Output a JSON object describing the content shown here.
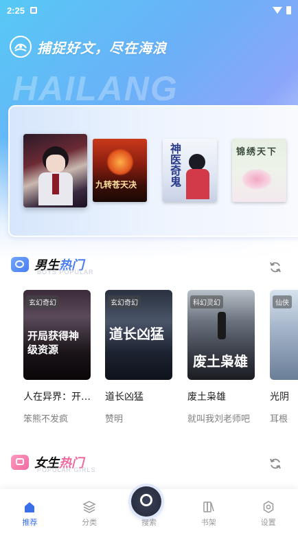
{
  "status_bar": {
    "time": "2:25"
  },
  "hero": {
    "slogan": "捕捉好文，尽在海浪",
    "watermark": "HAILANG"
  },
  "carousel": {
    "covers": [
      {
        "name": "anime-character-cover",
        "text": ""
      },
      {
        "name": "jiuxing-cover",
        "text": "九转苍天决"
      },
      {
        "name": "shenyi-cover",
        "text": "神医奇鬼"
      },
      {
        "name": "jinxiu-cover",
        "text": "锦绣天下"
      }
    ]
  },
  "sections": [
    {
      "title_main": "男生",
      "title_accent": "热门",
      "subtitle": "BOYS POPULAR",
      "books": [
        {
          "title": "人在异界：开…",
          "author": "笨熊不发疯",
          "tag": "玄幻奇幻",
          "cover_text": "开局获得神级资源"
        },
        {
          "title": "道长凶猛",
          "author": "赞明",
          "tag": "玄幻奇幻",
          "cover_text": "道长凶猛"
        },
        {
          "title": "废土枭雄",
          "author": "就叫我刘老师吧",
          "tag": "科幻灵幻",
          "cover_text": "废土枭雄"
        },
        {
          "title": "光阴",
          "author": "耳根",
          "tag": "仙侠",
          "cover_text": ""
        }
      ]
    },
    {
      "title_main": "女生",
      "title_accent": "热门",
      "subtitle": "POPULAR GIRLS"
    }
  ],
  "bottom_nav": {
    "items": [
      {
        "label": "推荐",
        "icon": "home-icon",
        "active": true
      },
      {
        "label": "分类",
        "icon": "layers-icon",
        "active": false
      },
      {
        "label": "搜索",
        "icon": "search-icon",
        "active": false
      },
      {
        "label": "书架",
        "icon": "bookshelf-icon",
        "active": false
      },
      {
        "label": "设置",
        "icon": "settings-icon",
        "active": false
      }
    ]
  },
  "colors": {
    "accent": "#4a7cf0",
    "accent_pink": "#f06aa0",
    "nav_active": "#3a6fe8"
  }
}
